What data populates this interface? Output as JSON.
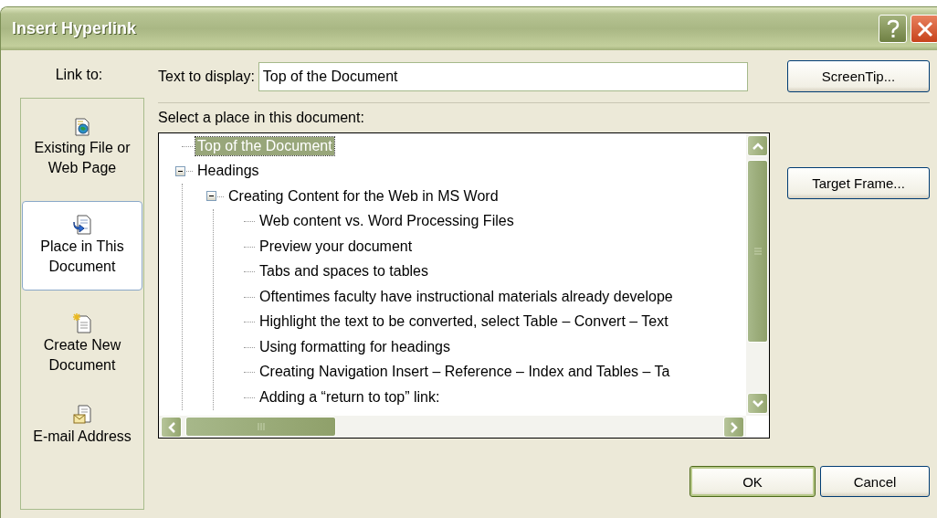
{
  "window": {
    "title": "Insert Hyperlink"
  },
  "link_to": {
    "label": "Link to:",
    "items": [
      {
        "label": "Existing File or Web Page",
        "kind": "file",
        "selected": false
      },
      {
        "label": "Place in This Document",
        "kind": "place",
        "selected": true
      },
      {
        "label": "Create New Document",
        "kind": "new",
        "selected": false
      },
      {
        "label": "E-mail Address",
        "kind": "email",
        "selected": false
      }
    ]
  },
  "text_to_display": {
    "label": "Text to display:",
    "value": "Top of the Document"
  },
  "place_label": "Select a place in this document:",
  "tree": [
    {
      "label": "Top of the Document",
      "selected": true
    },
    {
      "label": "Headings",
      "selected": false,
      "expanded": true,
      "children": [
        {
          "label": "Creating Content for the Web in MS Word",
          "selected": false,
          "expanded": true,
          "children": [
            {
              "label": "Web content vs. Word Processing Files",
              "selected": false
            },
            {
              "label": "Preview your document",
              "selected": false
            },
            {
              "label": "Tabs and spaces to tables",
              "selected": false
            },
            {
              "label": "Oftentimes faculty have instructional materials already develope",
              "selected": false
            },
            {
              "label": "Highlight the text to be converted, select Table – Convert – Text",
              "selected": false
            },
            {
              "label": "Using formatting for headings",
              "selected": false
            },
            {
              "label": "Creating Navigation  Insert – Reference – Index and Tables – Ta",
              "selected": false
            },
            {
              "label": "Adding a “return to top” link:",
              "selected": false
            }
          ]
        }
      ]
    }
  ],
  "side_buttons": [
    "ScreenTip...",
    "Target Frame..."
  ],
  "buttons": [
    {
      "label": "OK",
      "default": true
    },
    {
      "label": "Cancel",
      "default": false
    }
  ]
}
